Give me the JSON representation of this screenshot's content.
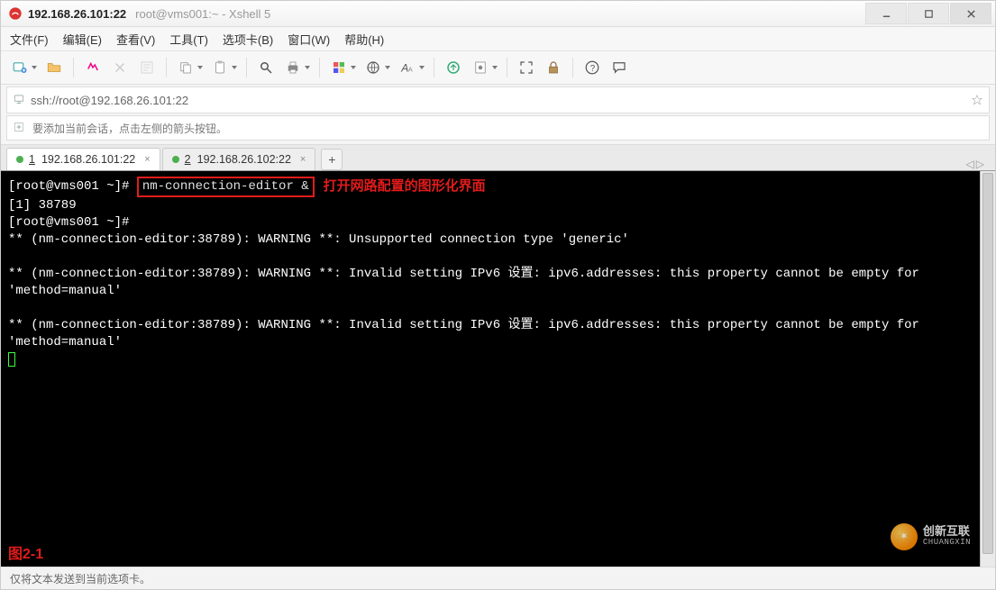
{
  "title": {
    "address": "192.168.26.101:22",
    "subtitle": "root@vms001:~ - Xshell 5"
  },
  "menu": {
    "file": "文件(F)",
    "edit": "编辑(E)",
    "view": "查看(V)",
    "tools": "工具(T)",
    "tabs": "选项卡(B)",
    "window": "窗口(W)",
    "help": "帮助(H)"
  },
  "addressbar": {
    "url": "ssh://root@192.168.26.101:22"
  },
  "hint": {
    "text": "要添加当前会话，点击左侧的箭头按钮。"
  },
  "tabs": [
    {
      "num": "1",
      "label": "192.168.26.101:22",
      "active": true
    },
    {
      "num": "2",
      "label": "192.168.26.102:22",
      "active": false
    }
  ],
  "terminal": {
    "line1_prompt": "[root@vms001 ~]# ",
    "line1_cmd": "nm-connection-editor &",
    "line1_annot": "打开网路配置的图形化界面",
    "line2": "[1] 38789",
    "line3": "[root@vms001 ~]# ",
    "line4": "** (nm-connection-editor:38789): WARNING **: Unsupported connection type 'generic'",
    "blank": "",
    "line5": "** (nm-connection-editor:38789): WARNING **: Invalid setting IPv6 设置: ipv6.addresses: this property cannot be empty for 'method=manual'",
    "line6": "** (nm-connection-editor:38789): WARNING **: Invalid setting IPv6 设置: ipv6.addresses: this property cannot be empty for 'method=manual'",
    "figure_label": "图2-1"
  },
  "status": {
    "text": "仅将文本发送到当前选项卡。"
  },
  "watermark": {
    "cn": "创新互联",
    "en": "CHUANGXIN"
  },
  "arrows": {
    "left": "◁",
    "right": "▷"
  },
  "plus": "+"
}
